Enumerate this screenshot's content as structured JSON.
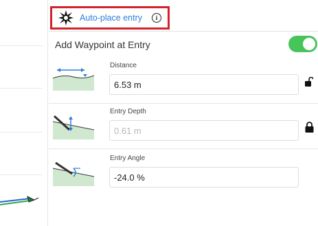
{
  "header": {
    "auto_place_label": "Auto-place entry",
    "icons": [
      "sparkle-star-icon",
      "info-icon"
    ]
  },
  "waypoint_toggle": {
    "label": "Add Waypoint at Entry",
    "enabled": true,
    "color": "#47c45a"
  },
  "fields": [
    {
      "label": "Distance",
      "value": "6.53 m",
      "disabled": false,
      "locked": false,
      "icon": "unlocked-padlock-icon"
    },
    {
      "label": "Entry Depth",
      "value": "0.61 m",
      "disabled": true,
      "locked": true,
      "icon": "locked-padlock-icon"
    },
    {
      "label": "Entry Angle",
      "value": "-24.0 %",
      "disabled": false,
      "locked": null,
      "icon": null
    }
  ],
  "colors": {
    "highlight_border": "#d3212d",
    "link_blue": "#2f7fd8",
    "terrain_green": "#cfe8cf"
  }
}
